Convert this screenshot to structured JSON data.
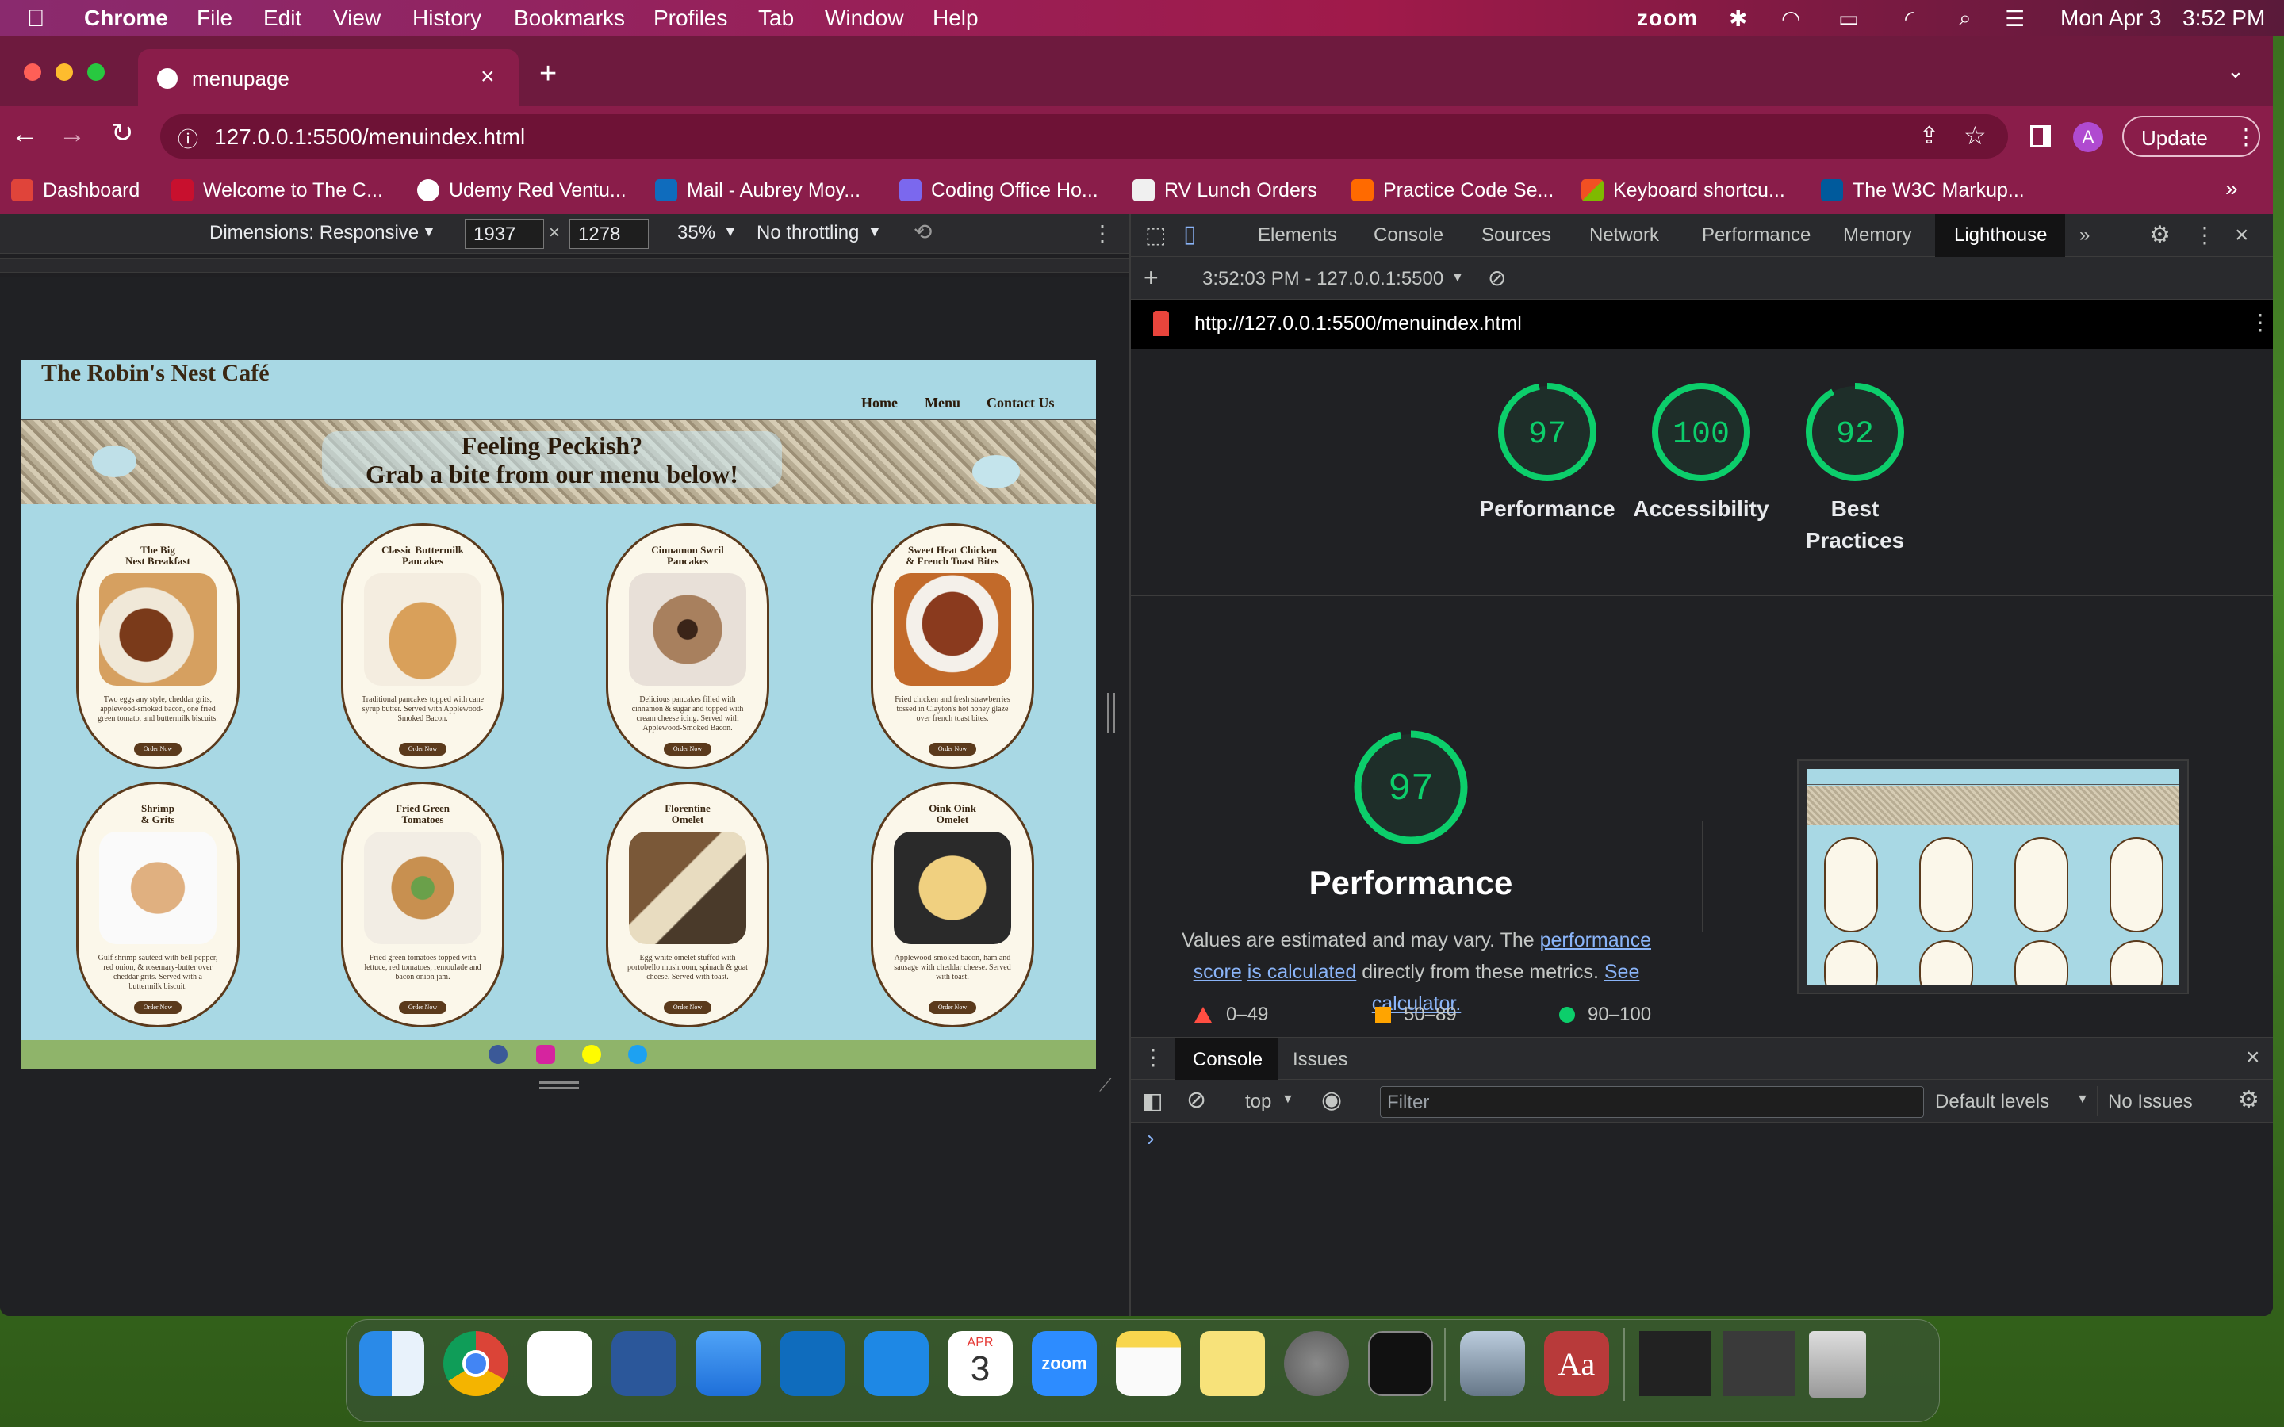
{
  "menubar": {
    "app": "Chrome",
    "items": [
      "File",
      "Edit",
      "View",
      "History",
      "Bookmarks",
      "Profiles",
      "Tab",
      "Window",
      "Help"
    ],
    "zoom": "zoom",
    "date": "Mon Apr 3",
    "time": "3:52 PM"
  },
  "tab": {
    "title": "menupage"
  },
  "address": {
    "url": "127.0.0.1:5500/menuindex.html"
  },
  "toolbar": {
    "update_label": "Update",
    "profile_initial": "A"
  },
  "bookmarks": [
    {
      "label": "Dashboard",
      "color": "#e0443a"
    },
    {
      "label": "Welcome to The C...",
      "color": "#c8102e"
    },
    {
      "label": "Udemy Red Ventu...",
      "color": "#ffffff"
    },
    {
      "label": "Mail - Aubrey Moy...",
      "color": "#0f6cbd"
    },
    {
      "label": "Coding Office Ho...",
      "color": "#7b68ee"
    },
    {
      "label": "RV Lunch Orders",
      "color": "#f0f0f0"
    },
    {
      "label": "Practice Code Se...",
      "color": "#ff6a00"
    },
    {
      "label": "Keyboard shortcu...",
      "color": "#f25022"
    },
    {
      "label": "The W3C Markup...",
      "color": "#005a9c"
    }
  ],
  "device": {
    "dimensions_label": "Dimensions: Responsive",
    "width": "1937",
    "height": "1278",
    "zoom": "35%",
    "throttle": "No throttling"
  },
  "site": {
    "brand": "The Robin's Nest Café",
    "nav": [
      "Home",
      "Menu",
      "Contact Us"
    ],
    "hero_line1": "Feeling Peckish?",
    "hero_line2": "Grab a bite from our menu below!",
    "order_label": "Order Now",
    "items": [
      {
        "title": "The Big\nNest Breakfast",
        "desc": "Two eggs any style, cheddar grits, applewood-smoked bacon, one fried green tomato, and buttermilk biscuits.",
        "color": "#b07850"
      },
      {
        "title": "Classic Buttermilk\nPancakes",
        "desc": "Traditional pancakes topped with cane syrup butter. Served with Applewood-Smoked Bacon.",
        "color": "#d9a05a"
      },
      {
        "title": "Cinnamon Swril\nPancakes",
        "desc": "Delicious pancakes filled with cinnamon & sugar and topped with cream cheese icing. Served with Applewood-Smoked Bacon.",
        "color": "#a8805e"
      },
      {
        "title": "Sweet Heat Chicken\n& French Toast Bites",
        "desc": "Fried chicken and fresh strawberries tossed in Clayton's hot honey glaze over french toast bites.",
        "color": "#8a3a1e"
      },
      {
        "title": "Shrimp\n& Grits",
        "desc": "Gulf shrimp sautéed with bell pepper, red onion, & rosemary-butter over cheddar grits. Served with a buttermilk biscuit.",
        "color": "#e0b080"
      },
      {
        "title": "Fried Green\nTomatoes",
        "desc": "Fried green tomatoes topped with lettuce, red tomatoes, remoulade and bacon onion jam.",
        "color": "#c89050"
      },
      {
        "title": "Florentine\nOmelet",
        "desc": "Egg white omelet stuffed with portobello mushroom, spinach & goat cheese. Served with toast.",
        "color": "#a07848"
      },
      {
        "title": "Oink Oink\nOmelet",
        "desc": "Applewood-smoked bacon, ham and sausage with cheddar cheese. Served with toast.",
        "color": "#e8c070"
      }
    ]
  },
  "devtools": {
    "tabs": [
      "Elements",
      "Console",
      "Sources",
      "Network",
      "Performance",
      "Memory",
      "Lighthouse"
    ],
    "active_tab": "Lighthouse",
    "report_time": "3:52:03 PM - 127.0.0.1:5500",
    "report_url": "http://127.0.0.1:5500/menuindex.html",
    "scores": [
      {
        "value": 97,
        "label": "Performance"
      },
      {
        "value": 100,
        "label": "Accessibility"
      },
      {
        "value": 92,
        "label": "Best\nPractices"
      }
    ],
    "perf_score": 97,
    "perf_title": "Performance",
    "perf_desc_1": "Values are estimated and may vary. The ",
    "perf_link_1": "performance score",
    "perf_link_2": "is calculated",
    "perf_desc_2": " directly from these metrics. ",
    "perf_link_3": "See calculator.",
    "legend": [
      "0–49",
      "50–89",
      "90–100"
    ],
    "score_color": "#0cce6b",
    "drawer_tabs": [
      "Console",
      "Issues"
    ],
    "context": "top",
    "filter_placeholder": "Filter",
    "levels": "Default levels",
    "issues": "No Issues",
    "prompt": "›"
  },
  "dock": {
    "calendar_month": "APR",
    "calendar_day": "3",
    "zoom_label": "zoom",
    "dictionary_label": "Aa"
  }
}
